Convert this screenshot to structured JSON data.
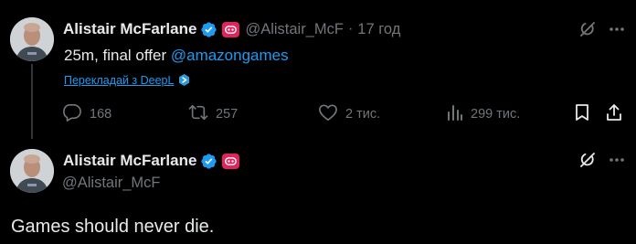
{
  "tweets": [
    {
      "display_name": "Alistair McFarlane",
      "handle": "@Alistair_McF",
      "separator": "·",
      "time": "17 год",
      "text_plain": "25m, final offer ",
      "mention": "@amazongames",
      "translate_label": "Перекладай з DeepL",
      "stats": {
        "replies": "168",
        "reposts": "257",
        "likes": "2 тис.",
        "views": "299 тис."
      }
    },
    {
      "display_name": "Alistair McFarlane",
      "handle": "@Alistair_McF",
      "text": "Games should never die."
    }
  ],
  "colors": {
    "background": "#000000",
    "text": "#e7e9ea",
    "muted": "#71767b",
    "accent": "#1d9bf0",
    "affiliation_badge": "#e0245e"
  },
  "icons": [
    "verified-badge-icon",
    "affiliation-badge-icon",
    "grok-icon",
    "more-icon",
    "reply-icon",
    "repost-icon",
    "like-icon",
    "views-icon",
    "bookmark-icon",
    "share-icon",
    "deepl-icon"
  ]
}
